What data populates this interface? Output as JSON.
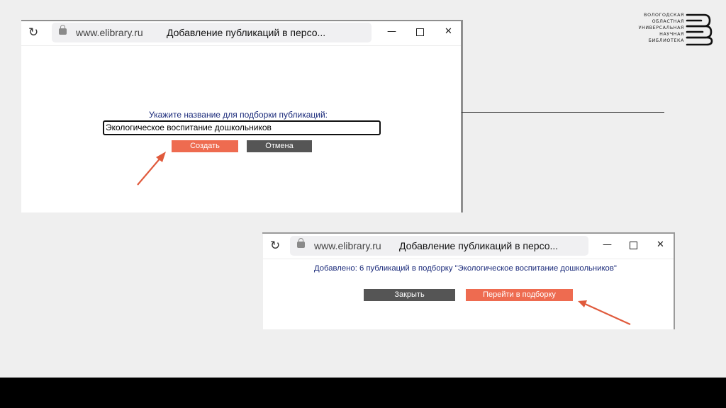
{
  "logo": {
    "lines": [
      "ВОЛОГОДСКАЯ",
      "ОБЛАСТНАЯ",
      "УНИВЕРСАЛЬНАЯ",
      "НАУЧНАЯ",
      "БИБЛИОТЕКА"
    ]
  },
  "window1": {
    "url": "www.elibrary.ru",
    "title": "Добавление публикаций в персо...",
    "minimize": "—",
    "close": "✕",
    "prompt": "Укажите название для подборки публикаций:",
    "input_value": "Экологическое воспитание дошкольников",
    "create_label": "Создать",
    "cancel_label": "Отмена"
  },
  "window2": {
    "url": "www.elibrary.ru",
    "title": "Добавление публикаций в персо...",
    "minimize": "—",
    "close": "✕",
    "message": "Добавлено: 6 публикаций в подборку \"Экологическое воспитание дошкольников\"",
    "close_label": "Закрыть",
    "goto_label": "Перейти в подборку"
  },
  "colors": {
    "accent": "#ee6b50",
    "dark_button": "#555555",
    "prompt_text": "#1a2a7a"
  }
}
